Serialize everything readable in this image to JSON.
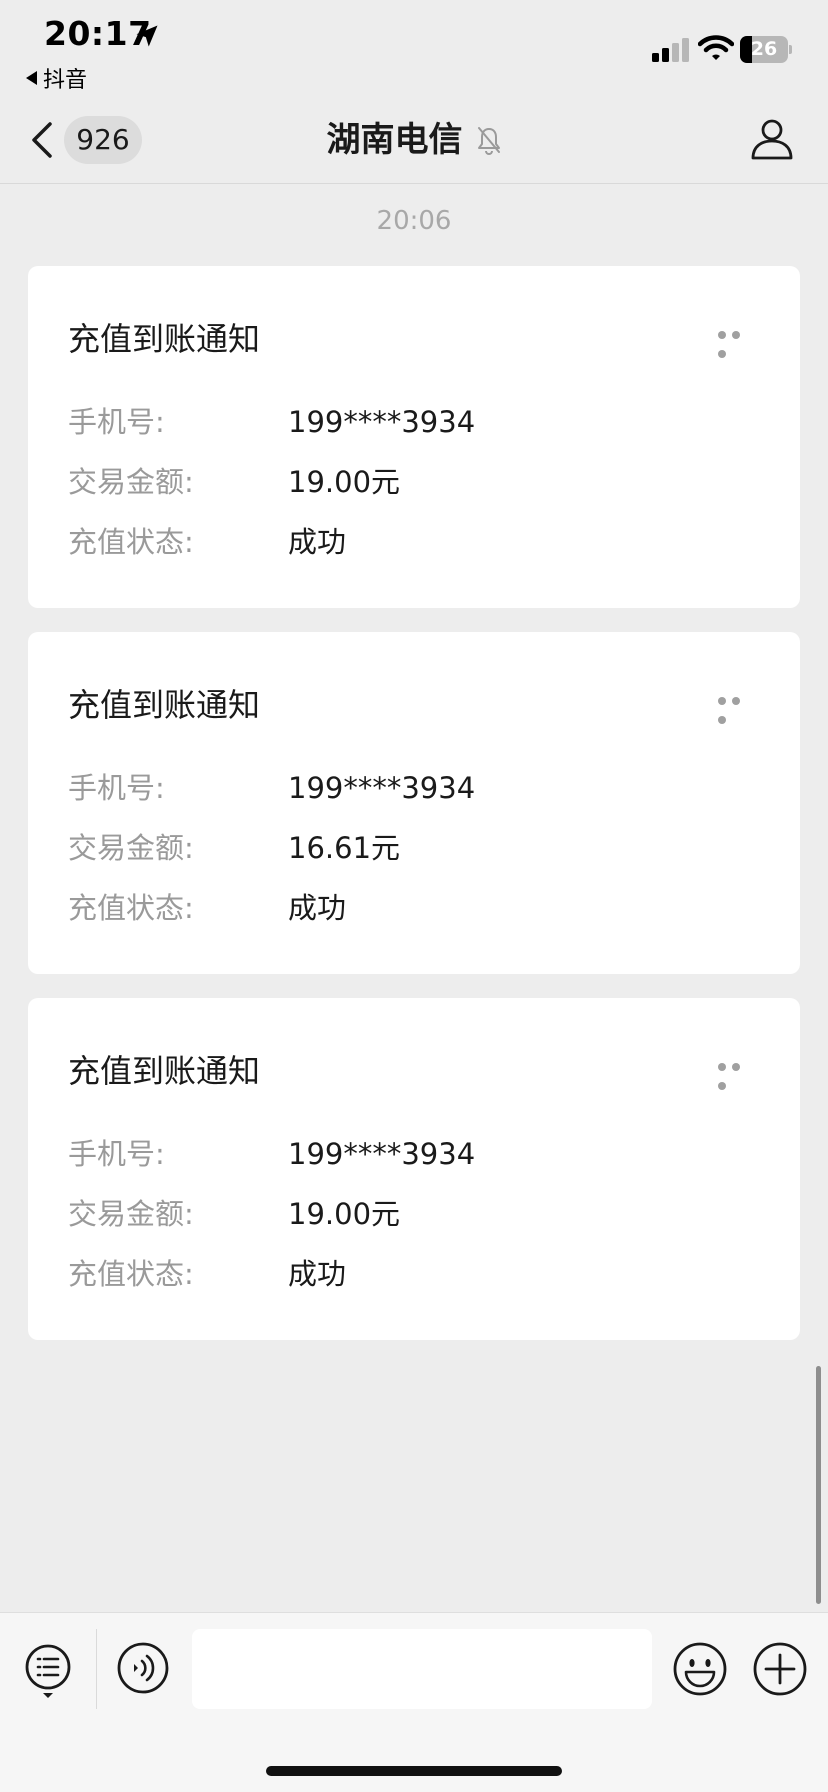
{
  "status_bar": {
    "time": "20:17",
    "back_app_label": "抖音",
    "battery_level": "26",
    "battery_fraction": 0.26
  },
  "nav": {
    "unread_count": "926",
    "title": "湖南电信"
  },
  "messages": {
    "timestamp": "20:06",
    "cards": [
      {
        "title": "充值到账通知",
        "rows": [
          {
            "label": "手机号:",
            "value": "199****3934"
          },
          {
            "label": "交易金额:",
            "value": "19.00元"
          },
          {
            "label": "充值状态:",
            "value": "成功"
          }
        ]
      },
      {
        "title": "充值到账通知",
        "rows": [
          {
            "label": "手机号:",
            "value": "199****3934"
          },
          {
            "label": "交易金额:",
            "value": "16.61元"
          },
          {
            "label": "充值状态:",
            "value": "成功"
          }
        ]
      },
      {
        "title": "充值到账通知",
        "rows": [
          {
            "label": "手机号:",
            "value": "199****3934"
          },
          {
            "label": "交易金额:",
            "value": "19.00元"
          },
          {
            "label": "充值状态:",
            "value": "成功"
          }
        ]
      }
    ]
  },
  "input_bar": {
    "message_value": "",
    "message_placeholder": ""
  },
  "icons": {
    "status": [
      "location-arrow-icon",
      "signal-icon",
      "wifi-icon",
      "battery-icon"
    ],
    "nav": [
      "back-chevron-icon",
      "mute-bell-icon",
      "profile-icon"
    ],
    "card": [
      "more-dots-icon"
    ],
    "input": [
      "menu-list-icon",
      "voice-icon",
      "emoji-icon",
      "plus-icon"
    ]
  },
  "colors": {
    "background": "#ededed",
    "card": "#ffffff",
    "label_text": "#9a9a9a",
    "value_text": "#1a1a1a",
    "timestamp_text": "#a8a8a8"
  }
}
